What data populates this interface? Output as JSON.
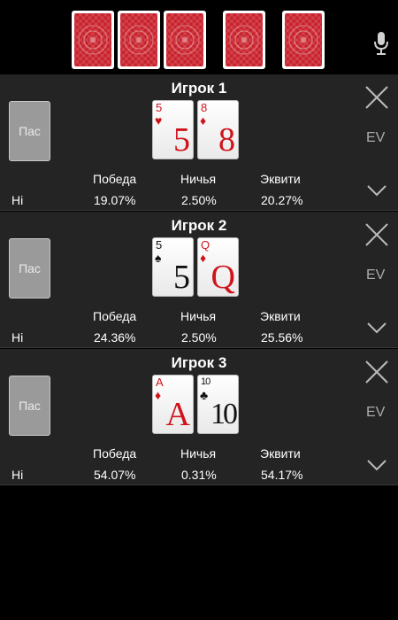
{
  "board": {
    "cards": [
      {
        "face": "down"
      },
      {
        "face": "down"
      },
      {
        "face": "down"
      },
      {
        "face": "down"
      },
      {
        "face": "down"
      }
    ],
    "card_back_color": "#c8212b",
    "mic_icon": "microphone-icon"
  },
  "labels": {
    "win": "Победа",
    "tie": "Ничья",
    "equity": "Эквити",
    "fold": "Пас",
    "ev": "EV"
  },
  "players": [
    {
      "title": "Игрок 1",
      "hand_type": "Hi",
      "cards": [
        {
          "rank": "5",
          "suit": "♥",
          "color": "red"
        },
        {
          "rank": "8",
          "suit": "♦",
          "color": "red"
        }
      ],
      "win": "19.07%",
      "tie": "2.50%",
      "equity": "20.27%"
    },
    {
      "title": "Игрок 2",
      "hand_type": "Hi",
      "cards": [
        {
          "rank": "5",
          "suit": "♠",
          "color": "black"
        },
        {
          "rank": "Q",
          "suit": "♦",
          "color": "red"
        }
      ],
      "win": "24.36%",
      "tie": "2.50%",
      "equity": "25.56%"
    },
    {
      "title": "Игрок 3",
      "hand_type": "Hi",
      "cards": [
        {
          "rank": "A",
          "suit": "♦",
          "color": "red"
        },
        {
          "rank": "10",
          "suit": "♣",
          "color": "black"
        }
      ],
      "win": "54.07%",
      "tie": "0.31%",
      "equity": "54.17%"
    }
  ],
  "colors": {
    "panel_bg": "#242424",
    "red_suit": "#d0121b",
    "fold_button": "#9a9a9a"
  }
}
